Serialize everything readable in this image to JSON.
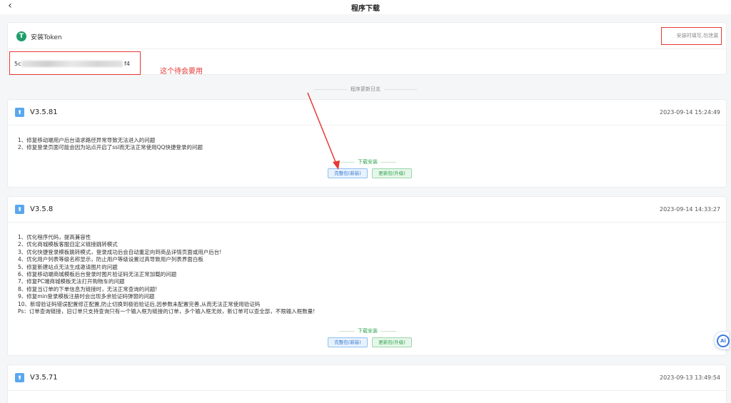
{
  "header": {
    "title": "程序下载",
    "back_glyph": "‹"
  },
  "token": {
    "title": "安装Token",
    "hint": "安装时填写,勿泄漏",
    "value_prefix": "5c",
    "value_suffix": "f4",
    "icon": "token-icon"
  },
  "annotation": {
    "note": "这个待会要用"
  },
  "log_divider": "程序更新日志",
  "versions": [
    {
      "version": "V3.5.81",
      "date": "2023-09-14 15:24:49",
      "notes": [
        "1、修复移动端用户后台请求路径异常导致无法进入的问题",
        "2、修复登录页面可能会因为站点开启了ssl而无法正常使用QQ快捷登录的问题"
      ],
      "download_label": "下载安装",
      "full_label": "完整包(新装)",
      "update_label": "更新包(升级)"
    },
    {
      "version": "V3.5.8",
      "date": "2023-09-14 14:33:27",
      "notes": [
        "1、优化程序代码，提高兼容性",
        "2、优化商城模板客服自定义链接跳转模式",
        "3、优化快捷登录模板跳转模式，登录成功后会自动重定向到商品详情页面或用户后台!",
        "4、优化用户列表等级名称显示，防止用户等级设置过高导致用户列表界面白板",
        "5、修复新建站点无法生成邀请图片的问题",
        "6、修复移动端商城模板后台登录时图片验证码无法正常加载的问题",
        "7、修复PC端商城模板无法打开购物车的问题",
        "8、修复当订单的下单信息为链接时，无法正常查询的问题!",
        "9、修复min登录模板注册时会出现多余验证码弹窗的问题",
        "10、新增验证码错误配置修正配置,防止切换到极验验证后,因参数未配置完善,从而无法正常使用验证码",
        "Ps：订单查询链接，旧订单只支持查询只有一个输入框为链接的订单，多个输入框无效，新订单可以查全部，不限输入框数量!"
      ],
      "download_label": "下载安装",
      "full_label": "完整包(新装)",
      "update_label": "更新包(升级)"
    },
    {
      "version": "V3.5.71",
      "date": "2023-09-13 13:49:54",
      "notes": [],
      "download_label": "",
      "full_label": "",
      "update_label": ""
    }
  ],
  "float_button": {
    "label": "Ai"
  },
  "colors": {
    "accent_red": "#e53935",
    "accent_blue": "#3a7bd5",
    "accent_green": "#2fa44f",
    "token_green": "#1e9e6b"
  }
}
